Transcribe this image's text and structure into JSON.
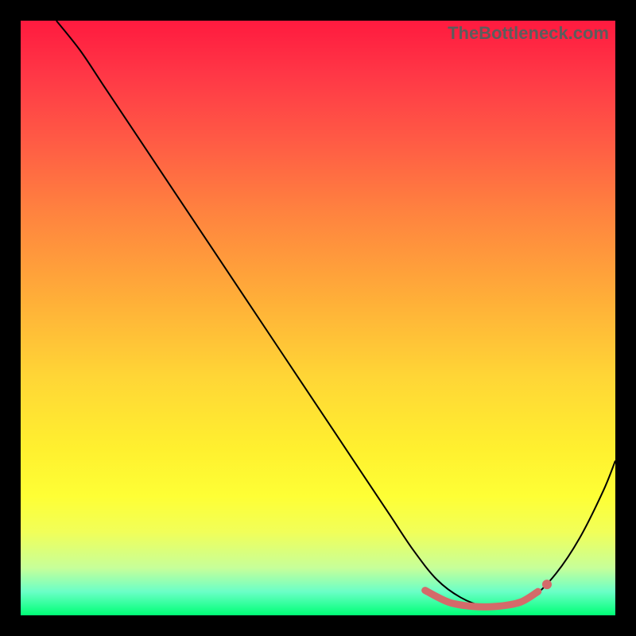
{
  "watermark": "TheBottleneck.com",
  "colors": {
    "curve": "#000000",
    "marker": "#d46a6a",
    "background_top": "#ff1a3f",
    "background_bottom": "#00ff76",
    "frame": "#000000"
  },
  "chart_data": {
    "type": "line",
    "title": "",
    "xlabel": "",
    "ylabel": "",
    "xlim": [
      0,
      100
    ],
    "ylim": [
      0,
      100
    ],
    "series": [
      {
        "name": "bottleneck-curve",
        "x": [
          6,
          10,
          14,
          20,
          26,
          32,
          38,
          44,
          50,
          56,
          62,
          66,
          70,
          74,
          78,
          82,
          86,
          90,
          94,
          98,
          100
        ],
        "y": [
          100,
          95,
          89,
          80,
          71,
          62,
          53,
          44,
          35,
          26,
          17,
          11,
          6,
          3,
          1.5,
          1.5,
          3,
          7,
          13,
          21,
          26
        ]
      }
    ],
    "markers": {
      "name": "optimal-range",
      "x": [
        68,
        72,
        76,
        80,
        84,
        87
      ],
      "y": [
        4.2,
        2.2,
        1.5,
        1.5,
        2.2,
        4.0
      ]
    },
    "end_marker": {
      "x": 88.5,
      "y": 5.2
    }
  }
}
